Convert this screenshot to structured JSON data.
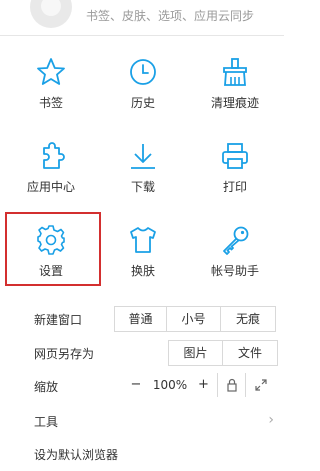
{
  "header": {
    "account_text": "书签、皮肤、选项、应用云同步"
  },
  "grid": [
    {
      "label": "书签"
    },
    {
      "label": "历史"
    },
    {
      "label": "清理痕迹"
    },
    {
      "label": "应用中心"
    },
    {
      "label": "下载"
    },
    {
      "label": "打印"
    },
    {
      "label": "设置"
    },
    {
      "label": "换肤"
    },
    {
      "label": "帐号助手"
    }
  ],
  "new_window": {
    "label": "新建窗口",
    "options": [
      "普通",
      "小号",
      "无痕"
    ]
  },
  "save_page": {
    "label": "网页另存为",
    "options": [
      "图片",
      "文件"
    ]
  },
  "zoom": {
    "label": "缩放",
    "minus": "−",
    "value": "100%",
    "plus": "+"
  },
  "tools": {
    "label": "工具",
    "chevron": "›"
  },
  "default_browser": {
    "label": "设为默认浏览器"
  },
  "colors": {
    "icon_blue": "#1aa0e6",
    "highlight_red": "#d32f2f"
  }
}
